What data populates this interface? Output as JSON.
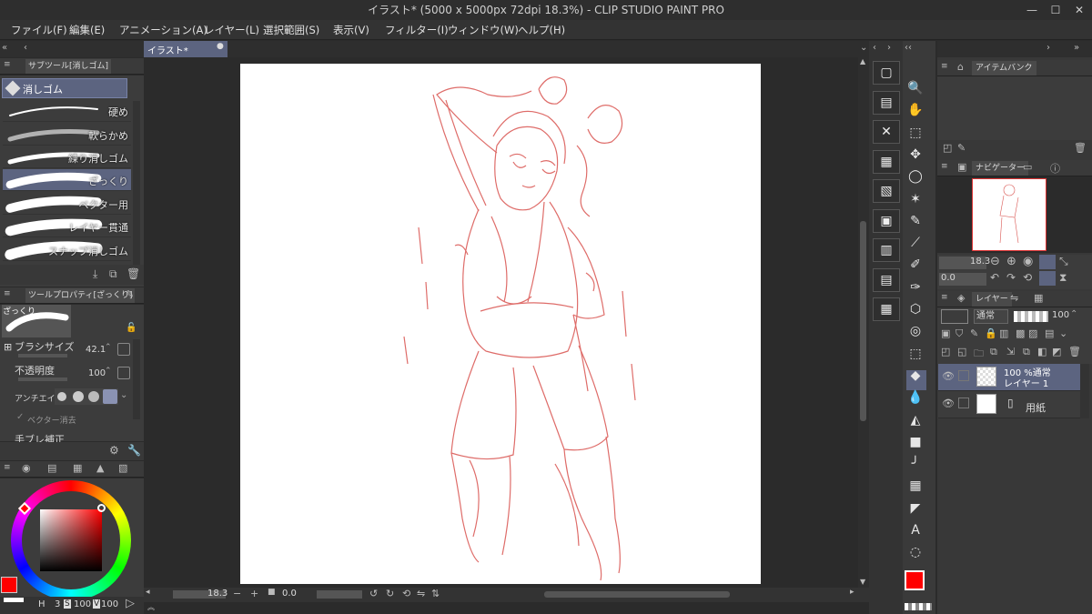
{
  "window": {
    "title": "イラスト* (5000 x 5000px 72dpi 18.3%)  - CLIP STUDIO PAINT PRO",
    "min": "—",
    "max": "☐",
    "close": "✕"
  },
  "menu": [
    "ファイル(F)",
    "編集(E)",
    "アニメーション(A)",
    "レイヤー(L)",
    "選択範囲(S)",
    "表示(V)",
    "フィルター(I)",
    "ウィンドウ(W)",
    "ヘルプ(H)"
  ],
  "canvas_tab": {
    "label": "イラスト*"
  },
  "subtool": {
    "header": "サブツール[消しゴム]",
    "group": "消しゴム",
    "brushes": [
      "硬め",
      "軟らかめ",
      "練り消しゴム",
      "ざっくり",
      "ベクター用",
      "レイヤー貫通",
      "スナップ消しゴム"
    ],
    "selected_index": 3
  },
  "tool_property": {
    "header": "ツールプロパティ[ざっくり]",
    "preview_name": "ざっくり",
    "brush_size_label": "ブラシサイズ",
    "brush_size": "42.1",
    "opacity_label": "不透明度",
    "opacity": "100",
    "antialias_label": "アンチエイリ",
    "vector_label": "ベクター消去",
    "stabilize_label": "手ブレ補正"
  },
  "color": {
    "main": "#ff0000",
    "bar_h": "H",
    "bar_h_value": "3",
    "bar_s": "S",
    "bar_s_value": "100",
    "bar_v": "V",
    "bar_v_value": "100"
  },
  "status": {
    "zoom": "18.3",
    "rotate": "0.0"
  },
  "item_bank": {
    "header": "アイテムバンク"
  },
  "navigator": {
    "header": "ナビゲーター",
    "zoom": "18.3",
    "rotate": "0.0"
  },
  "layer_panel": {
    "header": "レイヤー",
    "blend": "通常",
    "opacity": "100",
    "layers": [
      {
        "line1": "100 %通常",
        "line2": "レイヤー 1",
        "selected": true
      },
      {
        "line1": "",
        "line2": "用紙",
        "selected": false
      }
    ]
  },
  "tools": [
    "🔍",
    "✋",
    "⬚",
    "✥",
    "◯",
    "✶",
    "✎",
    "⟋",
    "✐",
    "✑",
    "⬡",
    "◎",
    "⬚",
    "◆",
    "💧",
    "◭",
    "■",
    "╯",
    "▦",
    "◤",
    "A",
    "◌"
  ],
  "commands": [
    "▢",
    "▤",
    "✕",
    "▦",
    "▧",
    "▣",
    "▥",
    "▤",
    "▦",
    "♿"
  ],
  "accent": "#6f7aa6",
  "selected_bg": "#5c6480"
}
